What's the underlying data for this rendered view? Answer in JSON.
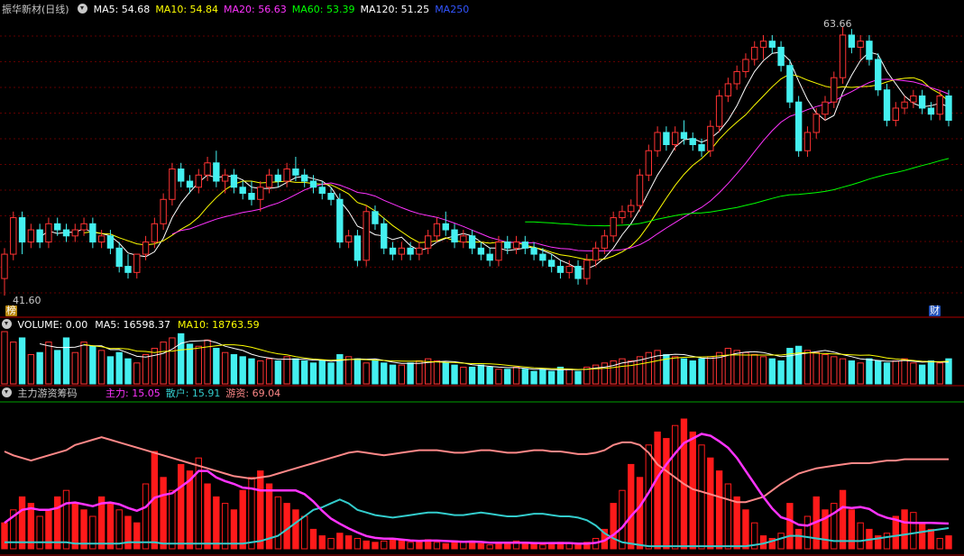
{
  "main_panel": {
    "stock_name": "振华新材(日线)",
    "ma_labels": [
      {
        "text": "MA5: 54.68",
        "color": "#ffffff"
      },
      {
        "text": "MA10: 54.84",
        "color": "#ffff00"
      },
      {
        "text": "MA20: 56.63",
        "color": "#ff33ff"
      },
      {
        "text": "MA60: 53.39",
        "color": "#00ff00"
      },
      {
        "text": "MA120: 51.25",
        "color": "#ffffff"
      },
      {
        "text": "MA250",
        "color": "#3355ff"
      }
    ],
    "high_label": "63.66",
    "low_label": "41.60",
    "badge_left": "榜",
    "badge_right": "财"
  },
  "volume_panel": {
    "labels": [
      {
        "text": "VOLUME: 0.00",
        "color": "#ffffff"
      },
      {
        "text": "MA5: 16598.37",
        "color": "#ffffff"
      },
      {
        "text": "MA10: 18763.59",
        "color": "#ffff00"
      }
    ]
  },
  "indicator_panel": {
    "title": "主力游资筹码",
    "labels": [
      {
        "text": "主力: 15.05",
        "color": "#ff33ff"
      },
      {
        "text": "散户: 15.91",
        "color": "#33cccc"
      },
      {
        "text": "游资: 69.04",
        "color": "#ff8888"
      }
    ]
  },
  "chart_data": [
    {
      "type": "candlestick",
      "title": "振华新材(日线)",
      "ylim": [
        41.6,
        63.66
      ],
      "annotations": [
        "63.66",
        "41.60"
      ],
      "ohlc": [
        [
          43.0,
          45.5,
          41.6,
          45.0
        ],
        [
          45.0,
          48.5,
          44.5,
          48.0
        ],
        [
          48.0,
          48.5,
          45.0,
          46.0
        ],
        [
          46.0,
          47.5,
          45.5,
          47.0
        ],
        [
          47.0,
          47.5,
          45.5,
          46.0
        ],
        [
          46.0,
          48.0,
          45.5,
          47.5
        ],
        [
          47.5,
          48.0,
          46.5,
          47.0
        ],
        [
          47.0,
          47.5,
          46.0,
          46.5
        ],
        [
          46.5,
          47.5,
          46.0,
          47.0
        ],
        [
          47.0,
          48.0,
          46.5,
          47.5
        ],
        [
          47.5,
          48.0,
          45.5,
          46.0
        ],
        [
          46.0,
          47.0,
          45.5,
          46.5
        ],
        [
          46.5,
          47.0,
          45.0,
          45.5
        ],
        [
          45.5,
          46.0,
          43.5,
          44.0
        ],
        [
          44.0,
          45.0,
          43.0,
          43.5
        ],
        [
          43.5,
          45.0,
          43.0,
          45.0
        ],
        [
          45.0,
          46.5,
          44.5,
          46.0
        ],
        [
          46.0,
          48.0,
          45.5,
          47.5
        ],
        [
          47.5,
          50.0,
          47.0,
          49.5
        ],
        [
          49.5,
          52.5,
          49.0,
          52.0
        ],
        [
          52.0,
          52.5,
          50.5,
          51.0
        ],
        [
          51.0,
          51.5,
          50.0,
          50.5
        ],
        [
          50.5,
          52.0,
          50.0,
          51.5
        ],
        [
          51.5,
          53.0,
          51.0,
          52.5
        ],
        [
          52.5,
          53.5,
          50.5,
          51.0
        ],
        [
          51.0,
          52.0,
          50.0,
          51.5
        ],
        [
          51.5,
          52.0,
          50.0,
          50.5
        ],
        [
          50.5,
          51.0,
          49.5,
          50.0
        ],
        [
          50.0,
          51.0,
          49.0,
          49.5
        ],
        [
          49.5,
          51.0,
          48.5,
          50.5
        ],
        [
          50.5,
          52.0,
          50.0,
          51.5
        ],
        [
          51.5,
          52.0,
          50.5,
          51.0
        ],
        [
          51.0,
          52.5,
          50.5,
          52.0
        ],
        [
          52.0,
          53.0,
          51.0,
          51.5
        ],
        [
          51.5,
          52.0,
          50.5,
          51.0
        ],
        [
          51.0,
          51.5,
          50.0,
          50.5
        ],
        [
          50.5,
          51.0,
          49.5,
          50.0
        ],
        [
          50.0,
          50.5,
          49.0,
          49.5
        ],
        [
          49.5,
          50.0,
          45.5,
          46.0
        ],
        [
          46.0,
          47.0,
          45.5,
          46.5
        ],
        [
          46.5,
          47.0,
          44.0,
          44.5
        ],
        [
          44.5,
          49.0,
          44.0,
          48.5
        ],
        [
          48.5,
          49.0,
          47.0,
          47.5
        ],
        [
          47.5,
          48.0,
          45.0,
          45.5
        ],
        [
          45.5,
          46.0,
          44.5,
          45.0
        ],
        [
          45.0,
          46.0,
          44.5,
          45.5
        ],
        [
          45.5,
          46.0,
          44.5,
          45.0
        ],
        [
          45.0,
          46.0,
          44.5,
          45.5
        ],
        [
          45.5,
          47.0,
          45.0,
          46.5
        ],
        [
          46.5,
          48.0,
          46.0,
          47.5
        ],
        [
          47.5,
          48.5,
          46.5,
          47.0
        ],
        [
          47.0,
          47.5,
          45.5,
          46.0
        ],
        [
          46.0,
          47.0,
          45.5,
          46.5
        ],
        [
          46.5,
          47.0,
          45.0,
          45.5
        ],
        [
          45.5,
          46.0,
          44.5,
          45.0
        ],
        [
          45.0,
          45.5,
          44.0,
          44.5
        ],
        [
          44.5,
          46.5,
          44.0,
          46.0
        ],
        [
          46.0,
          46.5,
          45.0,
          45.5
        ],
        [
          45.5,
          46.5,
          45.0,
          46.0
        ],
        [
          46.0,
          46.5,
          45.0,
          45.5
        ],
        [
          45.5,
          46.0,
          44.5,
          45.0
        ],
        [
          45.0,
          45.5,
          44.0,
          44.5
        ],
        [
          44.5,
          45.0,
          43.5,
          44.0
        ],
        [
          44.0,
          44.5,
          43.0,
          43.5
        ],
        [
          43.5,
          44.5,
          43.0,
          44.0
        ],
        [
          44.0,
          44.5,
          42.5,
          43.0
        ],
        [
          43.0,
          45.0,
          42.5,
          44.5
        ],
        [
          44.5,
          46.0,
          44.0,
          45.5
        ],
        [
          45.5,
          47.0,
          45.0,
          46.5
        ],
        [
          46.5,
          48.5,
          46.0,
          48.0
        ],
        [
          48.0,
          49.0,
          47.5,
          48.5
        ],
        [
          48.5,
          49.5,
          48.0,
          49.0
        ],
        [
          49.0,
          52.0,
          48.5,
          51.5
        ],
        [
          51.5,
          54.0,
          51.0,
          53.5
        ],
        [
          53.5,
          55.5,
          53.0,
          55.0
        ],
        [
          55.0,
          55.5,
          53.5,
          54.0
        ],
        [
          54.0,
          55.5,
          53.5,
          55.0
        ],
        [
          55.0,
          56.0,
          54.0,
          54.5
        ],
        [
          54.5,
          55.0,
          53.5,
          54.0
        ],
        [
          54.0,
          54.5,
          53.0,
          53.5
        ],
        [
          53.5,
          56.0,
          53.0,
          55.5
        ],
        [
          55.5,
          58.5,
          55.0,
          58.0
        ],
        [
          58.0,
          59.5,
          57.5,
          59.0
        ],
        [
          59.0,
          60.5,
          58.5,
          60.0
        ],
        [
          60.0,
          61.5,
          59.5,
          61.0
        ],
        [
          61.0,
          62.5,
          60.5,
          62.0
        ],
        [
          62.0,
          63.0,
          61.0,
          62.5
        ],
        [
          62.5,
          63.0,
          61.5,
          62.0
        ],
        [
          62.0,
          62.5,
          60.0,
          60.5
        ],
        [
          60.5,
          61.0,
          57.0,
          57.5
        ],
        [
          57.5,
          58.0,
          53.0,
          53.5
        ],
        [
          53.5,
          55.5,
          53.0,
          55.0
        ],
        [
          55.0,
          57.0,
          54.5,
          56.5
        ],
        [
          56.5,
          58.0,
          56.0,
          57.5
        ],
        [
          57.5,
          60.0,
          57.0,
          59.5
        ],
        [
          59.5,
          63.66,
          59.0,
          63.0
        ],
        [
          63.0,
          63.5,
          61.5,
          62.0
        ],
        [
          62.0,
          63.0,
          61.0,
          62.5
        ],
        [
          62.5,
          63.0,
          60.5,
          61.0
        ],
        [
          61.0,
          61.5,
          58.0,
          58.5
        ],
        [
          58.5,
          59.0,
          55.5,
          56.0
        ],
        [
          56.0,
          57.5,
          55.5,
          57.0
        ],
        [
          57.0,
          58.0,
          56.5,
          57.5
        ],
        [
          57.5,
          58.5,
          57.0,
          58.0
        ],
        [
          58.0,
          58.5,
          56.5,
          57.0
        ],
        [
          57.0,
          57.5,
          56.0,
          56.5
        ],
        [
          56.5,
          58.5,
          56.0,
          58.0
        ],
        [
          58.0,
          58.5,
          55.5,
          56.0
        ]
      ]
    },
    {
      "type": "bar",
      "title": "VOLUME",
      "series": [
        {
          "name": "VOLUME",
          "values": [
            25,
            20,
            22,
            14,
            15,
            20,
            16,
            22,
            15,
            20,
            18,
            16,
            13,
            15,
            12,
            10,
            14,
            17,
            20,
            22,
            24,
            19,
            18,
            21,
            17,
            15,
            14,
            13,
            12,
            11,
            12,
            11,
            13,
            12,
            11,
            10,
            11,
            10,
            14,
            13,
            12,
            10,
            11,
            10,
            9,
            9,
            10,
            11,
            12,
            11,
            10,
            9,
            8,
            8,
            9,
            8,
            7,
            7,
            8,
            7,
            6,
            7,
            6,
            8,
            7,
            6,
            8,
            9,
            10,
            11,
            12,
            11,
            13,
            15,
            16,
            14,
            13,
            12,
            11,
            12,
            13,
            15,
            17,
            16,
            15,
            14,
            13,
            12,
            11,
            17,
            18,
            16,
            15,
            14,
            13,
            12,
            11,
            10,
            12,
            11,
            10,
            11,
            12,
            10,
            9,
            11,
            10,
            12
          ]
        }
      ]
    },
    {
      "type": "bar",
      "title": "主力游资筹码",
      "series": [
        {
          "name": "主力",
          "values": [
            20,
            30,
            40,
            35,
            25,
            30,
            40,
            45,
            35,
            30,
            25,
            40,
            35,
            30,
            25,
            20,
            50,
            75,
            55,
            45,
            65,
            60,
            70,
            50,
            40,
            35,
            30,
            45,
            55,
            60,
            50,
            40,
            35,
            30,
            25,
            15,
            10,
            8,
            12,
            10,
            8,
            6,
            5,
            6,
            8,
            7,
            5,
            6,
            7,
            5,
            4,
            6,
            5,
            6,
            4,
            3,
            5,
            4,
            6,
            5,
            4,
            3,
            4,
            5,
            4,
            3,
            5,
            8,
            15,
            35,
            45,
            65,
            55,
            80,
            90,
            85,
            95,
            100,
            90,
            80,
            70,
            60,
            50,
            40,
            30,
            20,
            10,
            8,
            12,
            35,
            15,
            25,
            40,
            30,
            35,
            45,
            30,
            20,
            15,
            10,
            12,
            25,
            30,
            28,
            20,
            15,
            8,
            10
          ]
        },
        {
          "name": "散户",
          "values": [
            5,
            5,
            5,
            5,
            5,
            5,
            5,
            5,
            4,
            4,
            4,
            4,
            4,
            4,
            5,
            5,
            5,
            5,
            4,
            4,
            4,
            4,
            4,
            4,
            4,
            4,
            4,
            4,
            5,
            6,
            8,
            10,
            15,
            20,
            25,
            30,
            32,
            35,
            38,
            35,
            30,
            28,
            26,
            25,
            24,
            25,
            26,
            27,
            28,
            28,
            27,
            26,
            26,
            27,
            28,
            27,
            26,
            25,
            25,
            26,
            27,
            27,
            26,
            25,
            25,
            24,
            22,
            18,
            12,
            8,
            5,
            4,
            3,
            2,
            2,
            2,
            2,
            2,
            2,
            2,
            2,
            2,
            2,
            2,
            2,
            3,
            4,
            6,
            8,
            10,
            10,
            9,
            8,
            7,
            6,
            6,
            6,
            6,
            7,
            8,
            9,
            10,
            11,
            12,
            13,
            14,
            15,
            16
          ]
        },
        {
          "name": "游资",
          "values": [
            75,
            72,
            70,
            68,
            70,
            72,
            74,
            76,
            80,
            82,
            84,
            86,
            84,
            82,
            80,
            78,
            76,
            74,
            72,
            70,
            68,
            66,
            64,
            62,
            60,
            58,
            56,
            55,
            54,
            55,
            56,
            58,
            60,
            62,
            64,
            66,
            68,
            70,
            72,
            74,
            75,
            74,
            73,
            72,
            73,
            74,
            75,
            76,
            76,
            76,
            75,
            74,
            74,
            75,
            76,
            76,
            75,
            74,
            74,
            75,
            76,
            76,
            75,
            75,
            74,
            73,
            73,
            74,
            76,
            80,
            82,
            82,
            80,
            74,
            65,
            60,
            55,
            50,
            46,
            44,
            42,
            40,
            38,
            36,
            36,
            38,
            40,
            45,
            50,
            54,
            58,
            60,
            62,
            63,
            64,
            65,
            66,
            66,
            66,
            67,
            68,
            68,
            69,
            69,
            69,
            69,
            69,
            69
          ]
        }
      ]
    }
  ]
}
